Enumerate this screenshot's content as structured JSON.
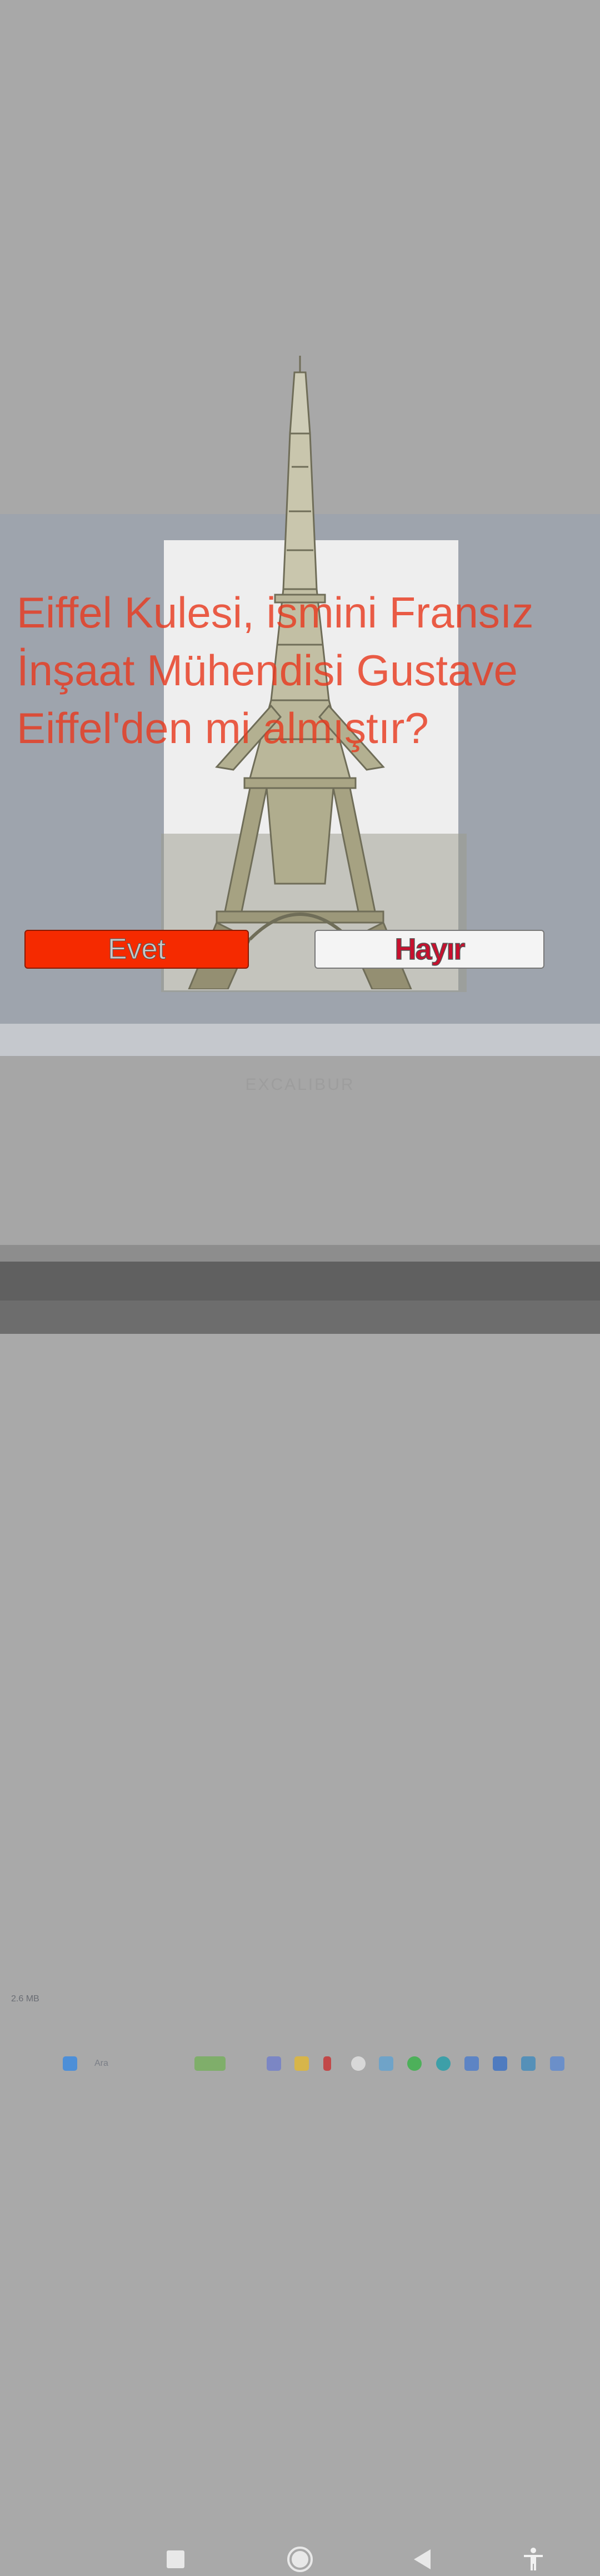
{
  "quiz": {
    "question": "Eiffel Kulesi, ismini Fransız İnşaat Mühendisi Gustave Eiffel'den mi almıştır?",
    "yes_label": "Evet",
    "no_label": "Hayır"
  },
  "background": {
    "file_size": "2.6 MB",
    "search_placeholder": "Ara",
    "brand": "EXCALIBUR"
  },
  "navbar": {
    "recents_icon": "square-icon",
    "home_icon": "circle-icon",
    "back_icon": "triangle-back-icon",
    "accessibility_icon": "accessibility-icon"
  },
  "colors": {
    "yes_button": "#f52a00",
    "no_button": "#f4f4f4",
    "question_text": "#e83b20"
  }
}
